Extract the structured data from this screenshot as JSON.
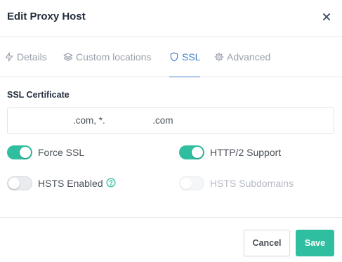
{
  "modal": {
    "title": "Edit Proxy Host",
    "close_icon": "close-icon"
  },
  "tabs": [
    {
      "label": "Details",
      "icon": "bolt-icon",
      "active": false
    },
    {
      "label": "Custom locations",
      "icon": "layers-icon",
      "active": false
    },
    {
      "label": "SSL",
      "icon": "shield-icon",
      "active": true
    },
    {
      "label": "Advanced",
      "icon": "gear-icon",
      "active": false
    }
  ],
  "ssl": {
    "section_label": "SSL Certificate",
    "certificate_value": ".com, *.                  .com",
    "toggles": {
      "force_ssl": {
        "label": "Force SSL",
        "checked": true,
        "disabled": false
      },
      "http2_support": {
        "label": "HTTP/2 Support",
        "checked": true,
        "disabled": false
      },
      "hsts_enabled": {
        "label": "HSTS Enabled",
        "checked": false,
        "disabled": false,
        "help_icon": "help-circle-icon"
      },
      "hsts_subdomains": {
        "label": "HSTS Subdomains",
        "checked": false,
        "disabled": true
      }
    }
  },
  "footer": {
    "cancel_label": "Cancel",
    "save_label": "Save"
  },
  "colors": {
    "accent": "#2fbfa0",
    "active_tab": "#467fcf",
    "muted": "#9aa0ac"
  }
}
